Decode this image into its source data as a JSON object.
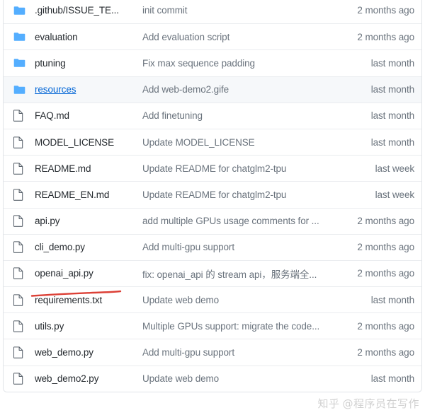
{
  "file_browser": {
    "columns": [
      "name",
      "commit_message",
      "updated"
    ],
    "rows": [
      {
        "icon": "folder-icon",
        "type": "folder",
        "name": ".github/ISSUE_TE...",
        "message": "init commit",
        "time": "2 months ago",
        "hovered": false,
        "link": false
      },
      {
        "icon": "folder-icon",
        "type": "folder",
        "name": "evaluation",
        "message": "Add evaluation script",
        "time": "2 months ago",
        "hovered": false,
        "link": false
      },
      {
        "icon": "folder-icon",
        "type": "folder",
        "name": "ptuning",
        "message": "Fix max sequence padding",
        "time": "last month",
        "hovered": false,
        "link": false
      },
      {
        "icon": "folder-icon",
        "type": "folder",
        "name": "resources",
        "message": "Add web-demo2.gife",
        "time": "last month",
        "hovered": true,
        "link": true
      },
      {
        "icon": "file-icon",
        "type": "file",
        "name": "FAQ.md",
        "message": "Add finetuning",
        "time": "last month",
        "hovered": false,
        "link": false
      },
      {
        "icon": "file-icon",
        "type": "file",
        "name": "MODEL_LICENSE",
        "message": "Update MODEL_LICENSE",
        "time": "last month",
        "hovered": false,
        "link": false
      },
      {
        "icon": "file-icon",
        "type": "file",
        "name": "README.md",
        "message": "Update README for chatglm2-tpu",
        "time": "last week",
        "hovered": false,
        "link": false
      },
      {
        "icon": "file-icon",
        "type": "file",
        "name": "README_EN.md",
        "message": "Update README for chatglm2-tpu",
        "time": "last week",
        "hovered": false,
        "link": false
      },
      {
        "icon": "file-icon",
        "type": "file",
        "name": "api.py",
        "message": "add multiple GPUs usage comments for ...",
        "time": "2 months ago",
        "hovered": false,
        "link": false
      },
      {
        "icon": "file-icon",
        "type": "file",
        "name": "cli_demo.py",
        "message": "Add multi-gpu support",
        "time": "2 months ago",
        "hovered": false,
        "link": false
      },
      {
        "icon": "file-icon",
        "type": "file",
        "name": "openai_api.py",
        "message": "fix: openai_api 的 stream api，服务端全...",
        "time": "2 months ago",
        "hovered": false,
        "link": false
      },
      {
        "icon": "file-icon",
        "type": "file",
        "name": "requirements.txt",
        "message": "Update web demo",
        "time": "last month",
        "hovered": false,
        "link": false
      },
      {
        "icon": "file-icon",
        "type": "file",
        "name": "utils.py",
        "message": "Multiple GPUs support: migrate the code...",
        "time": "2 months ago",
        "hovered": false,
        "link": false
      },
      {
        "icon": "file-icon",
        "type": "file",
        "name": "web_demo.py",
        "message": "Add multi-gpu support",
        "time": "2 months ago",
        "hovered": false,
        "link": false
      },
      {
        "icon": "file-icon",
        "type": "file",
        "name": "web_demo2.py",
        "message": "Update web demo",
        "time": "last month",
        "hovered": false,
        "link": false
      }
    ]
  },
  "annotation": {
    "type": "red-underline",
    "target": "openai_api.py",
    "color": "#d93025"
  },
  "watermark": {
    "logo": "知乎",
    "handle": "@程序员在写作",
    "color": "#c8c8c8"
  },
  "colors": {
    "folder_icon": "#54aeff",
    "link": "#0366d6",
    "text": "#24292e",
    "muted": "#6a737d",
    "row_border": "#eaecef",
    "hover_bg": "#f6f8fa"
  }
}
